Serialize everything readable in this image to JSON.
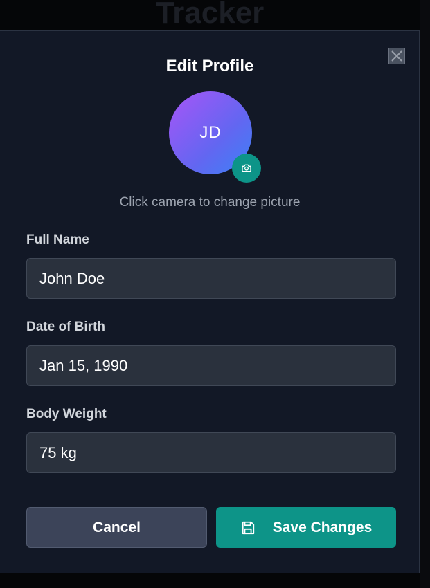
{
  "background": {
    "title": "Tracker"
  },
  "modal": {
    "title": "Edit Profile",
    "avatar_initials": "JD",
    "hint": "Click camera to change picture",
    "fields": {
      "full_name": {
        "label": "Full Name",
        "value": "John Doe"
      },
      "date_of_birth": {
        "label": "Date of Birth",
        "value": "Jan 15, 1990"
      },
      "body_weight": {
        "label": "Body Weight",
        "value": "75 kg"
      }
    },
    "buttons": {
      "cancel": "Cancel",
      "save": "Save Changes"
    },
    "icons": {
      "close": "close-icon",
      "camera": "camera-icon",
      "save": "save-icon"
    },
    "colors": {
      "accent": "#0d9488",
      "modal_bg": "#121826",
      "input_bg": "#2a313d",
      "cancel_bg": "#3c4459"
    }
  }
}
